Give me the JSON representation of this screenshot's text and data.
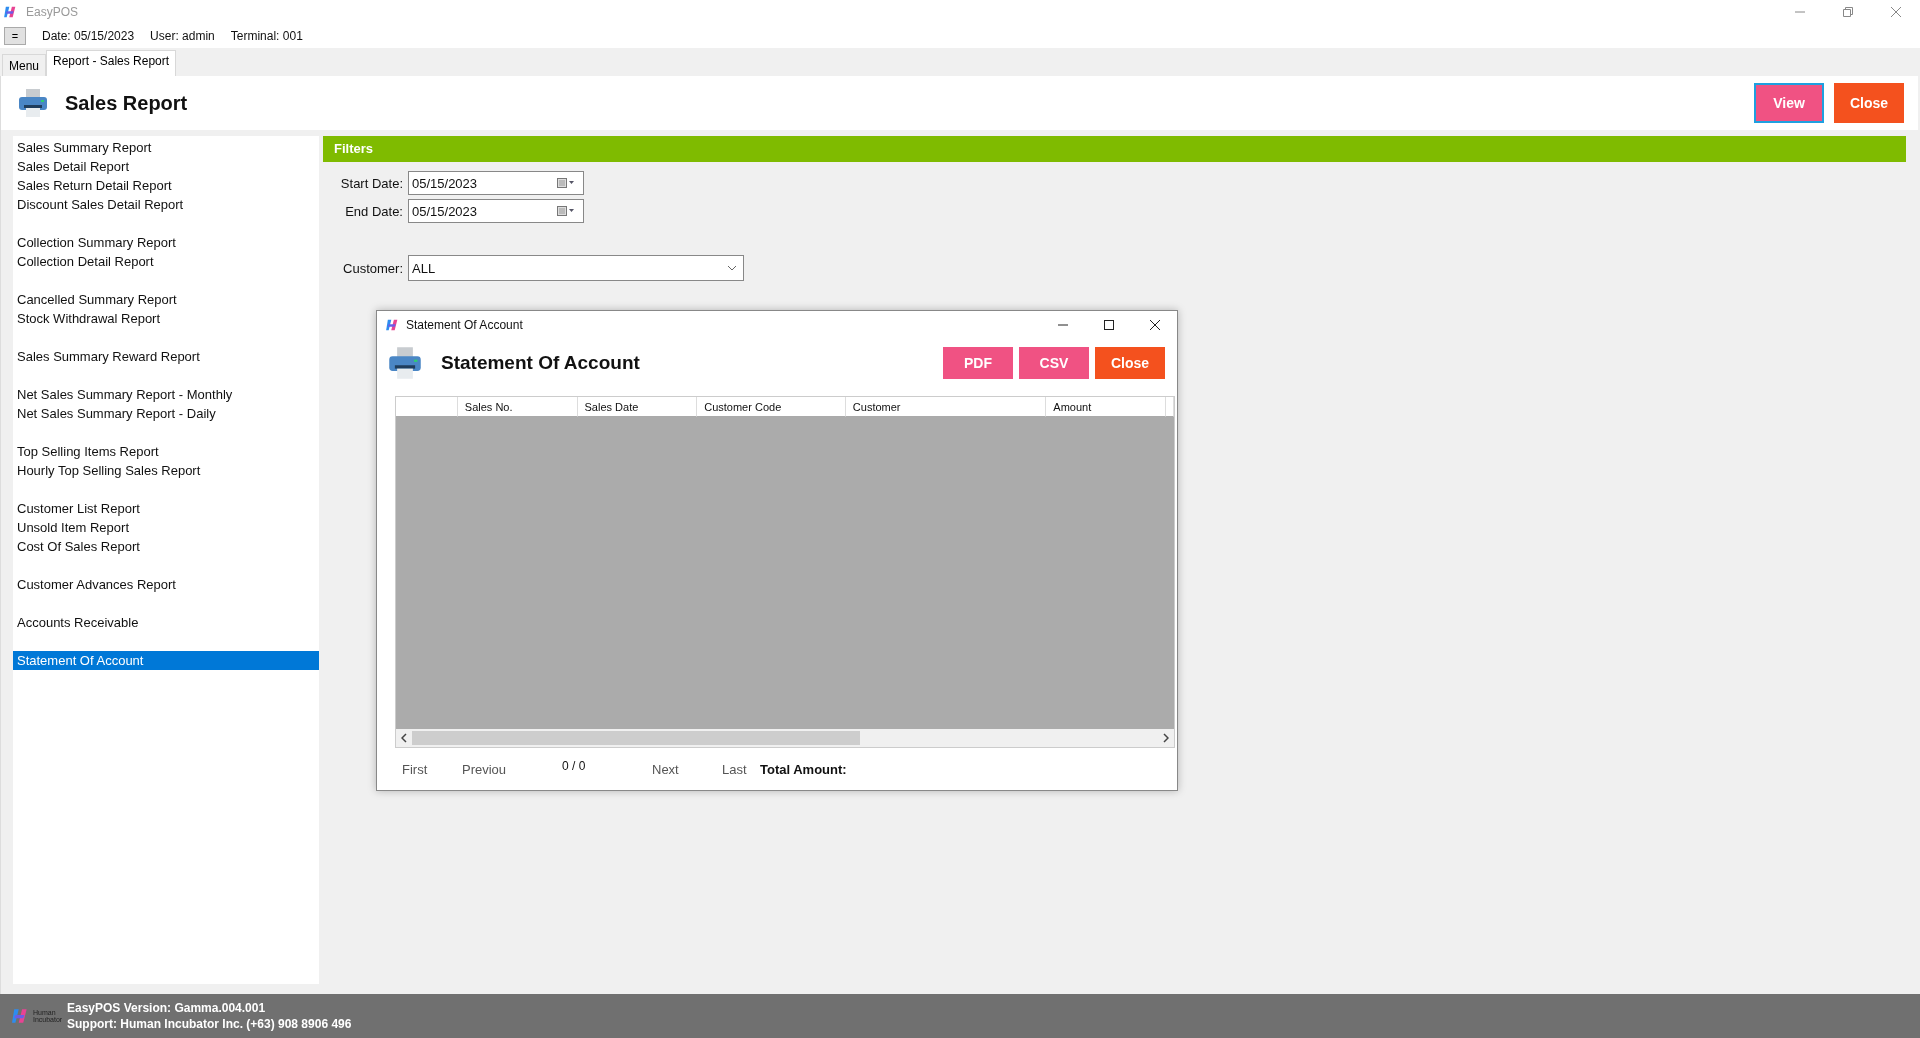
{
  "window": {
    "title": "EasyPOS"
  },
  "toolbar": {
    "menu_button": "=",
    "date": "Date: 05/15/2023",
    "user": "User: admin",
    "terminal": "Terminal: 001"
  },
  "tabs": [
    {
      "label": "Menu",
      "selected": false
    },
    {
      "label": "Report - Sales Report",
      "selected": true
    }
  ],
  "page": {
    "title": "Sales Report",
    "buttons": [
      {
        "label": "View",
        "kind": "primary"
      },
      {
        "label": "Close",
        "kind": "danger"
      }
    ]
  },
  "sidebar": {
    "groups": [
      [
        {
          "label": "Sales Summary Report",
          "selected": false
        },
        {
          "label": "Sales Detail Report",
          "selected": false
        },
        {
          "label": "Sales Return Detail Report",
          "selected": false
        },
        {
          "label": "Discount Sales Detail Report",
          "selected": false
        }
      ],
      [
        {
          "label": "Collection Summary Report",
          "selected": false
        },
        {
          "label": "Collection Detail Report",
          "selected": false
        }
      ],
      [
        {
          "label": "Cancelled Summary Report",
          "selected": false
        },
        {
          "label": "Stock Withdrawal Report",
          "selected": false
        }
      ],
      [
        {
          "label": "Sales Summary Reward Report",
          "selected": false
        }
      ],
      [
        {
          "label": "Net Sales Summary Report - Monthly",
          "selected": false
        },
        {
          "label": "Net Sales Summary Report - Daily",
          "selected": false
        }
      ],
      [
        {
          "label": "Top Selling Items Report",
          "selected": false
        },
        {
          "label": "Hourly Top Selling Sales Report",
          "selected": false
        }
      ],
      [
        {
          "label": "Customer List Report",
          "selected": false
        },
        {
          "label": "Unsold Item Report",
          "selected": false
        },
        {
          "label": "Cost Of Sales Report",
          "selected": false
        }
      ],
      [
        {
          "label": "Customer Advances Report",
          "selected": false
        }
      ],
      [
        {
          "label": "Accounts Receivable",
          "selected": false
        }
      ],
      [
        {
          "label": "Statement Of Account",
          "selected": true
        }
      ]
    ]
  },
  "filters": {
    "title": "Filters",
    "start_date": {
      "label": "Start Date:",
      "value": "05/15/2023"
    },
    "end_date": {
      "label": "End Date:",
      "value": "05/15/2023"
    },
    "customer": {
      "label": "Customer:",
      "value": "ALL"
    }
  },
  "dialog": {
    "title": "Statement Of Account",
    "heading": "Statement Of Account",
    "buttons": [
      {
        "label": "PDF",
        "kind": "primary"
      },
      {
        "label": "CSV",
        "kind": "primary"
      },
      {
        "label": "Close",
        "kind": "danger"
      }
    ],
    "table": {
      "columns": [
        "Sales No.",
        "Sales Date",
        "Customer Code",
        "Customer",
        "Amount"
      ]
    },
    "pager": {
      "first": "First",
      "previous": "Previou",
      "count": "0 / 0",
      "next": "Next",
      "last": "Last",
      "total_label": "Total Amount:"
    }
  },
  "status_bar": {
    "logo_text": "Human Incubator",
    "version": "EasyPOS Version: Gamma.004.001",
    "support": "Support: Human Incubator Inc. (+63) 908 8906 496"
  }
}
